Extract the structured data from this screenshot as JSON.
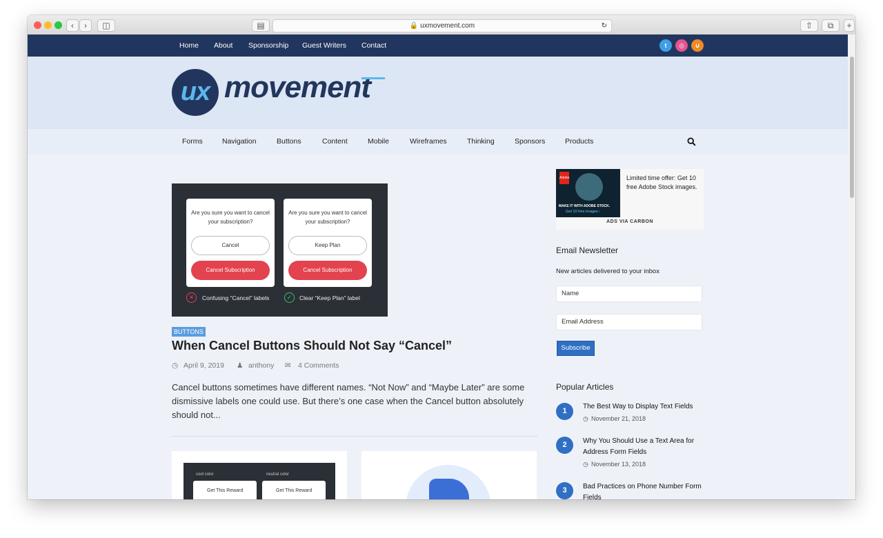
{
  "browser": {
    "url": "uxmovement.com"
  },
  "topnav": {
    "items": [
      "Home",
      "About",
      "Sponsorship",
      "Guest Writers",
      "Contact"
    ],
    "social": [
      "twitter-icon",
      "dribbble-icon",
      "rss-icon"
    ]
  },
  "brand": {
    "logo_mark": "ux",
    "logo_word": "movement"
  },
  "catnav": {
    "items": [
      "Forms",
      "Navigation",
      "Buttons",
      "Content",
      "Mobile",
      "Wireframes",
      "Thinking",
      "Sponsors",
      "Products"
    ]
  },
  "post": {
    "image": {
      "question": "Are you sure you want to cancel your subscription?",
      "left_secondary": "Cancel",
      "right_secondary": "Keep Plan",
      "primary": "Cancel Subscription",
      "bad_label": "Confusing “Cancel” labels",
      "good_label": "Clear “Keep Plan” label"
    },
    "category": "BUTTONS",
    "title": "When Cancel Buttons Should Not Say “Cancel”",
    "date": "April 9, 2019",
    "author": "anthony",
    "comments": "4 Comments",
    "excerpt": "Cancel buttons sometimes have different names. “Not Now” and “Maybe Later” are some dismissive labels one could use. But there’s one case when the Cancel button absolutely should not..."
  },
  "next_posts": {
    "thumb1": {
      "label_a": "cool color",
      "label_b": "neutral color",
      "button": "Get This Reward"
    }
  },
  "sidebar": {
    "ad": {
      "headline": "Limited time offer: Get 10 free Adobe Stock images.",
      "img_line1": "MAKE IT WITH ADOBE STOCK.",
      "img_line2": "Get 10 free images ›",
      "img_brand": "Adobe",
      "via": "ADS VIA CARBON"
    },
    "newsletter": {
      "heading": "Email Newsletter",
      "text": "New articles delivered to your inbox",
      "name_placeholder": "Name",
      "email_placeholder": "Email Address",
      "subscribe": "Subscribe"
    },
    "popular": {
      "heading": "Popular Articles",
      "items": [
        {
          "num": "1",
          "title": "The Best Way to Display Text Fields",
          "date": "November 21, 2018"
        },
        {
          "num": "2",
          "title": "Why You Should Use a Text Area for Address Form Fields",
          "date": "November 13, 2018"
        },
        {
          "num": "3",
          "title": "Bad Practices on Phone Number Form Fields",
          "date": ""
        }
      ]
    }
  },
  "colors": {
    "nav_bg": "#21365e",
    "header_bg": "#dde6f4",
    "accent": "#5bb7ee",
    "primary_button": "#2f6fc4",
    "danger": "#e3424f"
  }
}
